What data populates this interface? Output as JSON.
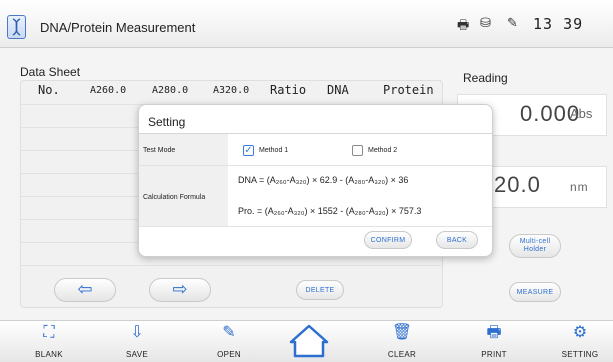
{
  "window": {
    "title": "DNA/Protein Measurement",
    "clock": "13 39"
  },
  "status_icons": [
    "printer-icon",
    "usb-icon",
    "pen-icon"
  ],
  "sheet": {
    "title": "Data Sheet",
    "columns": [
      "No.",
      "A260.0",
      "A280.0",
      "A320.0",
      "Ratio",
      "DNA",
      "Protein"
    ]
  },
  "buttons": {
    "prev": "⇦",
    "next": "⇨",
    "delete": "DELETE",
    "multicell_line1": "Multi-cell",
    "multicell_line2": "Holder",
    "measure": "MEASURE"
  },
  "reading": {
    "label": "Reading",
    "value": "0.000",
    "unit": "Abs",
    "wavelength": "20.0",
    "wavelength_unit": "nm"
  },
  "dialog": {
    "title": "Setting",
    "test_mode_label": "Test Mode",
    "method1": "Method 1",
    "method1_checked": true,
    "method2": "Method 2",
    "method2_checked": false,
    "formula_label": "Calculation Formula",
    "formula_dna": "DNA = (A₂₆₀-A₃₂₀) × 62.9 - (A₂₈₀-A₃₂₀) × 36",
    "formula_protein": "Pro. = (A₂₆₀-A₃₂₀) × 1552 - (A₂₈₀-A₃₂₀) × 757.3",
    "confirm": "CONFIRM",
    "back": "BACK"
  },
  "toolbar": [
    {
      "label": "BLANK",
      "icon": "blank-icon"
    },
    {
      "label": "SAVE",
      "icon": "save-icon"
    },
    {
      "label": "OPEN",
      "icon": "open-icon"
    },
    {
      "label": "",
      "icon": "home-icon"
    },
    {
      "label": "CLEAR",
      "icon": "trash-icon"
    },
    {
      "label": "PRINT",
      "icon": "printer-icon"
    },
    {
      "label": "SETTING",
      "icon": "gear-icon"
    }
  ],
  "colors": {
    "accent": "#2d6fcf",
    "check": "#3a7bd5"
  }
}
